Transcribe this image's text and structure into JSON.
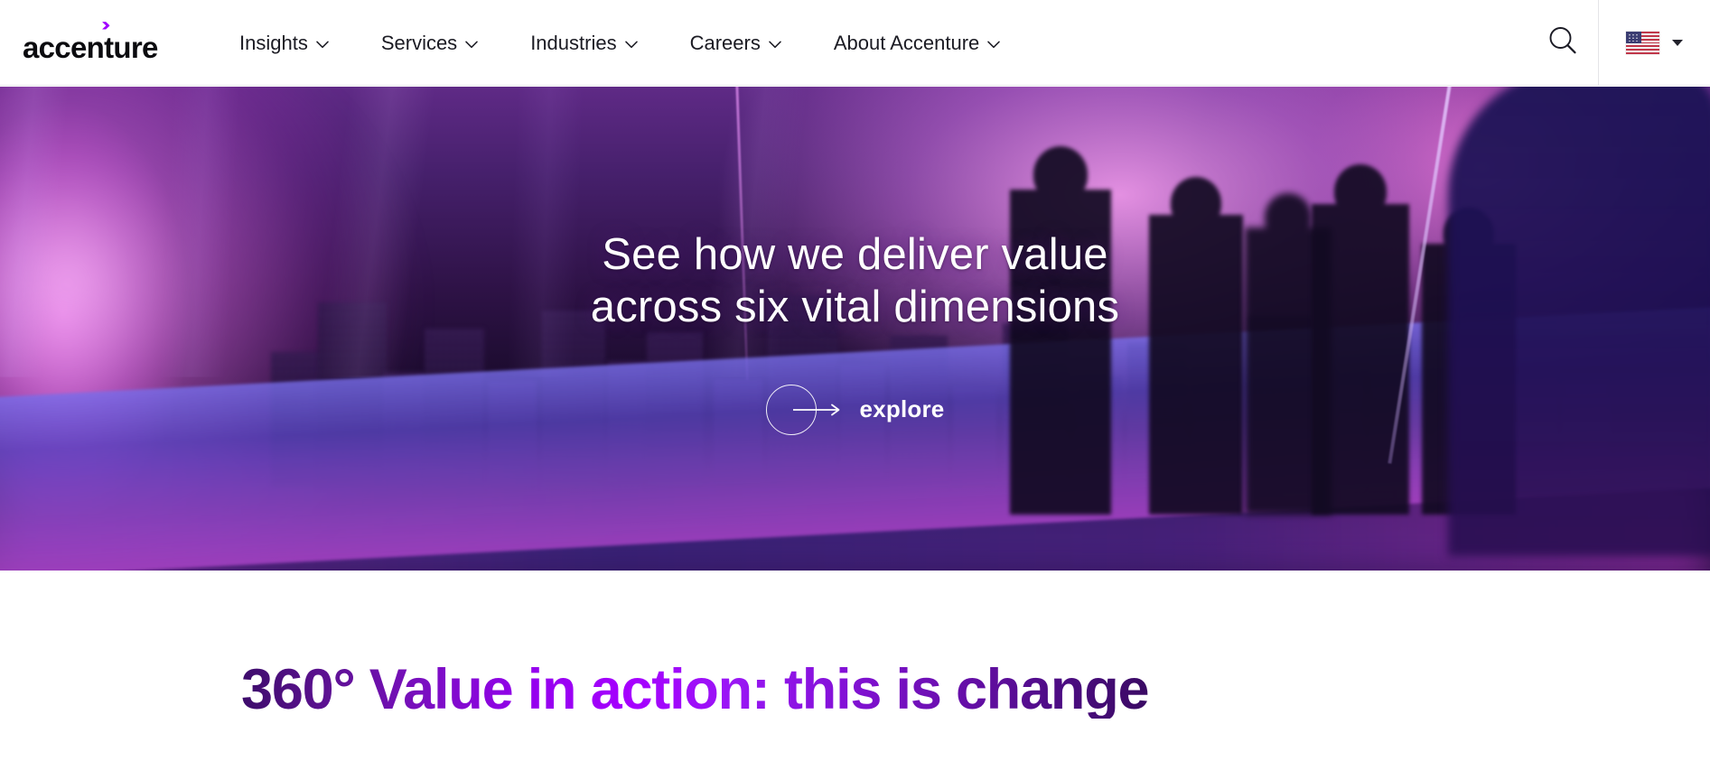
{
  "brand": {
    "logo_text": "accenture",
    "logo_arrow": "›",
    "accent_color": "#a100ff"
  },
  "nav": {
    "items": [
      {
        "label": "Insights",
        "icon": "chevron-down-icon"
      },
      {
        "label": "Services",
        "icon": "chevron-down-icon"
      },
      {
        "label": "Industries",
        "icon": "chevron-down-icon"
      },
      {
        "label": "Careers",
        "icon": "chevron-down-icon"
      },
      {
        "label": "About Accenture",
        "icon": "chevron-down-icon"
      }
    ],
    "search_icon": "search-icon",
    "locale_flag": "us-flag-icon",
    "locale_caret": "caret-down-icon"
  },
  "hero": {
    "title_line1": "See how we deliver value",
    "title_line2": "across six vital dimensions",
    "cta_label": "explore",
    "cta_icon": "arrow-right-icon",
    "background_alt": "people silhouetted on a glass observation deck overlooking a purple city skyline"
  },
  "section": {
    "heading": "360° Value in action: this is change",
    "gradient_from": "#3d0c6b",
    "gradient_mid": "#a600ff",
    "gradient_to": "#3a0a63"
  }
}
